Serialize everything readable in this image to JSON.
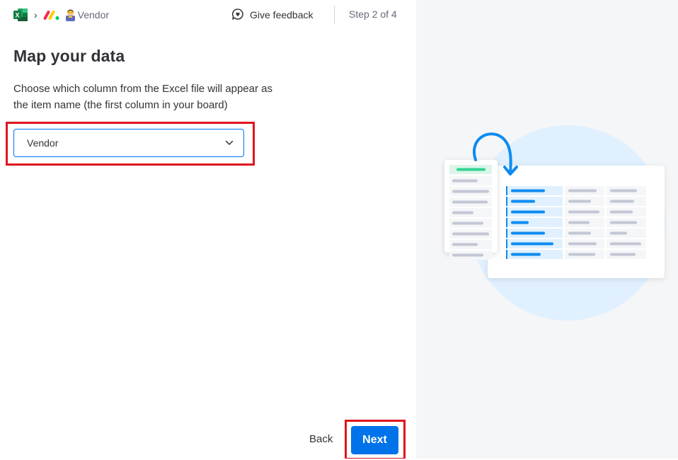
{
  "header": {
    "breadcrumb": {
      "excel_icon": "excel-icon",
      "separator": "›",
      "monday_icon": "monday-logo-icon",
      "person_icon": "person-icon",
      "current": "Vendor"
    },
    "feedback_label": "Give feedback",
    "step_label": "Step 2 of 4"
  },
  "main": {
    "title": "Map your data",
    "description_line1": "Choose which column from the Excel file will appear as",
    "description_line2": "the item name (the first column in your board)",
    "dropdown": {
      "selected": "Vendor",
      "icon": "chevron-down-icon"
    }
  },
  "footer": {
    "back_label": "Back",
    "next_label": "Next"
  },
  "colors": {
    "primary": "#0073ea",
    "highlight": "#e0141e",
    "panel_bg": "#f5f6f8",
    "illustration_circle": "#e0f0fe",
    "green_bar": "#33d391"
  }
}
